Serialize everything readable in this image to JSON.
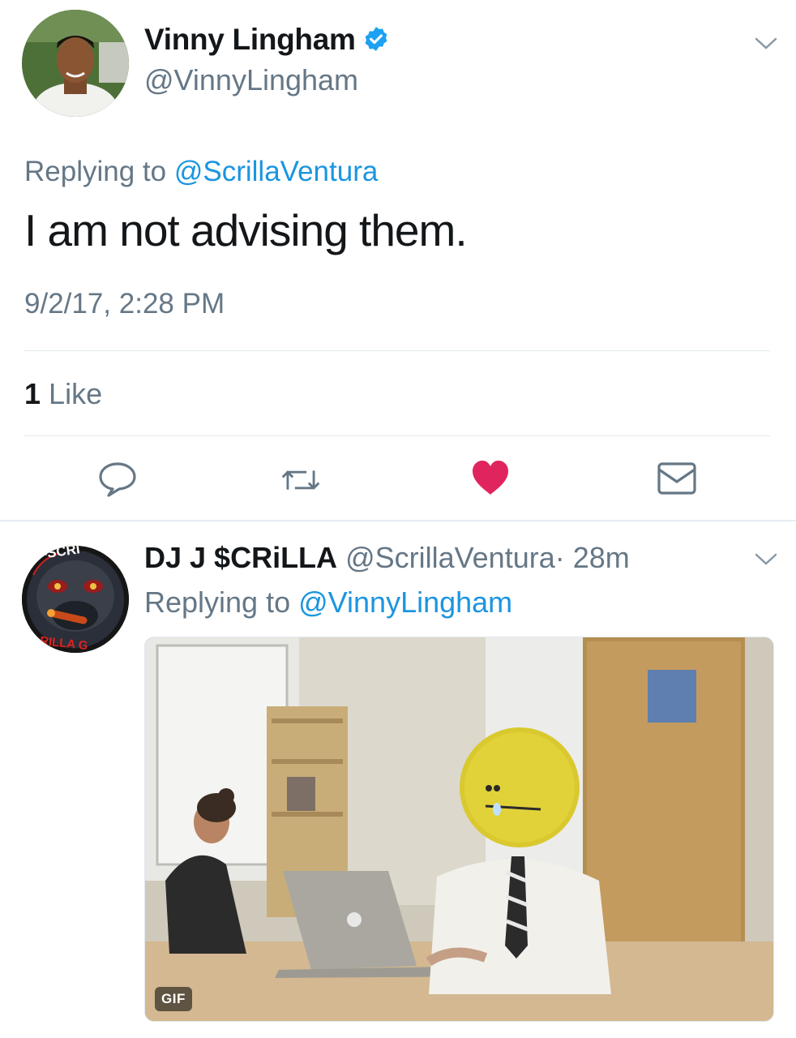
{
  "tweet": {
    "author_name": "Vinny Lingham",
    "author_handle": "@VinnyLingham",
    "replying_prefix": "Replying to",
    "replying_to": "@ScrillaVentura",
    "text": "I am not advising them.",
    "timestamp": "9/2/17, 2:28 PM",
    "like_count": "1",
    "like_label": "Like"
  },
  "actions": [
    "reply-icon",
    "retweet-icon",
    "heart-icon",
    "message-icon"
  ],
  "reply": {
    "author_name": "DJ J $CRiLLA",
    "author_handle": "@ScrillaVentura",
    "time": "· 28m",
    "replying_prefix": "Replying to",
    "replying_to": "@VinnyLingham",
    "media_badge": "GIF",
    "avatar_text_top": "J-SCRI",
    "avatar_text_bottom": "RILLA G"
  },
  "colors": {
    "link": "#1b95e0",
    "secondary_text": "#657786",
    "like": "#e0245e",
    "verified": "#1da1f2"
  }
}
